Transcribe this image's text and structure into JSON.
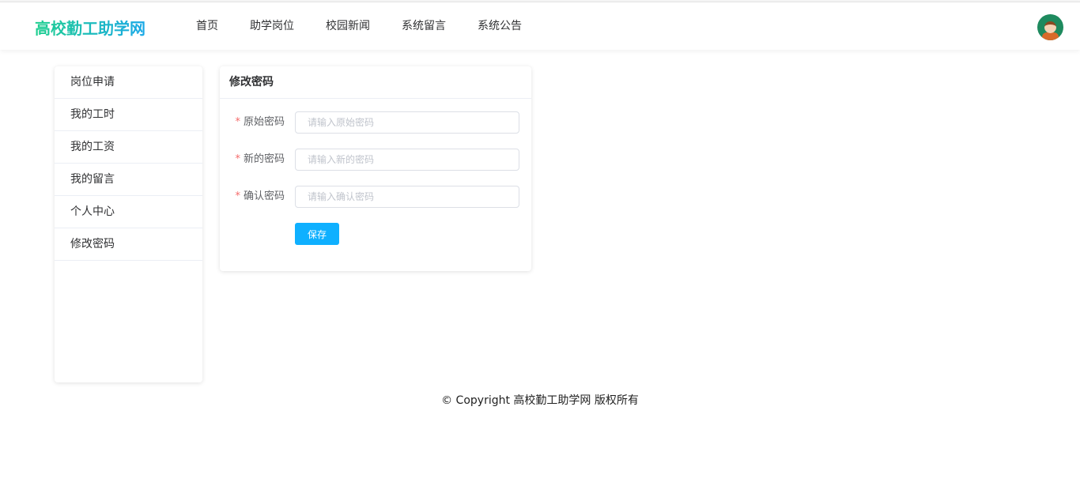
{
  "header": {
    "logo": "高校勤工助学网",
    "nav": [
      "首页",
      "助学岗位",
      "校园新闻",
      "系统留言",
      "系统公告"
    ]
  },
  "sidebar": {
    "items": [
      "岗位申请",
      "我的工时",
      "我的工资",
      "我的留言",
      "个人中心",
      "修改密码"
    ]
  },
  "form": {
    "title": "修改密码",
    "fields": [
      {
        "label": "原始密码",
        "placeholder": "请输入原始密码",
        "required": "*"
      },
      {
        "label": "新的密码",
        "placeholder": "请输入新的密码",
        "required": "*"
      },
      {
        "label": "确认密码",
        "placeholder": "请输入确认密码",
        "required": "*"
      }
    ],
    "save": "保存"
  },
  "footer": "© Copyright 高校勤工助学网 版权所有"
}
